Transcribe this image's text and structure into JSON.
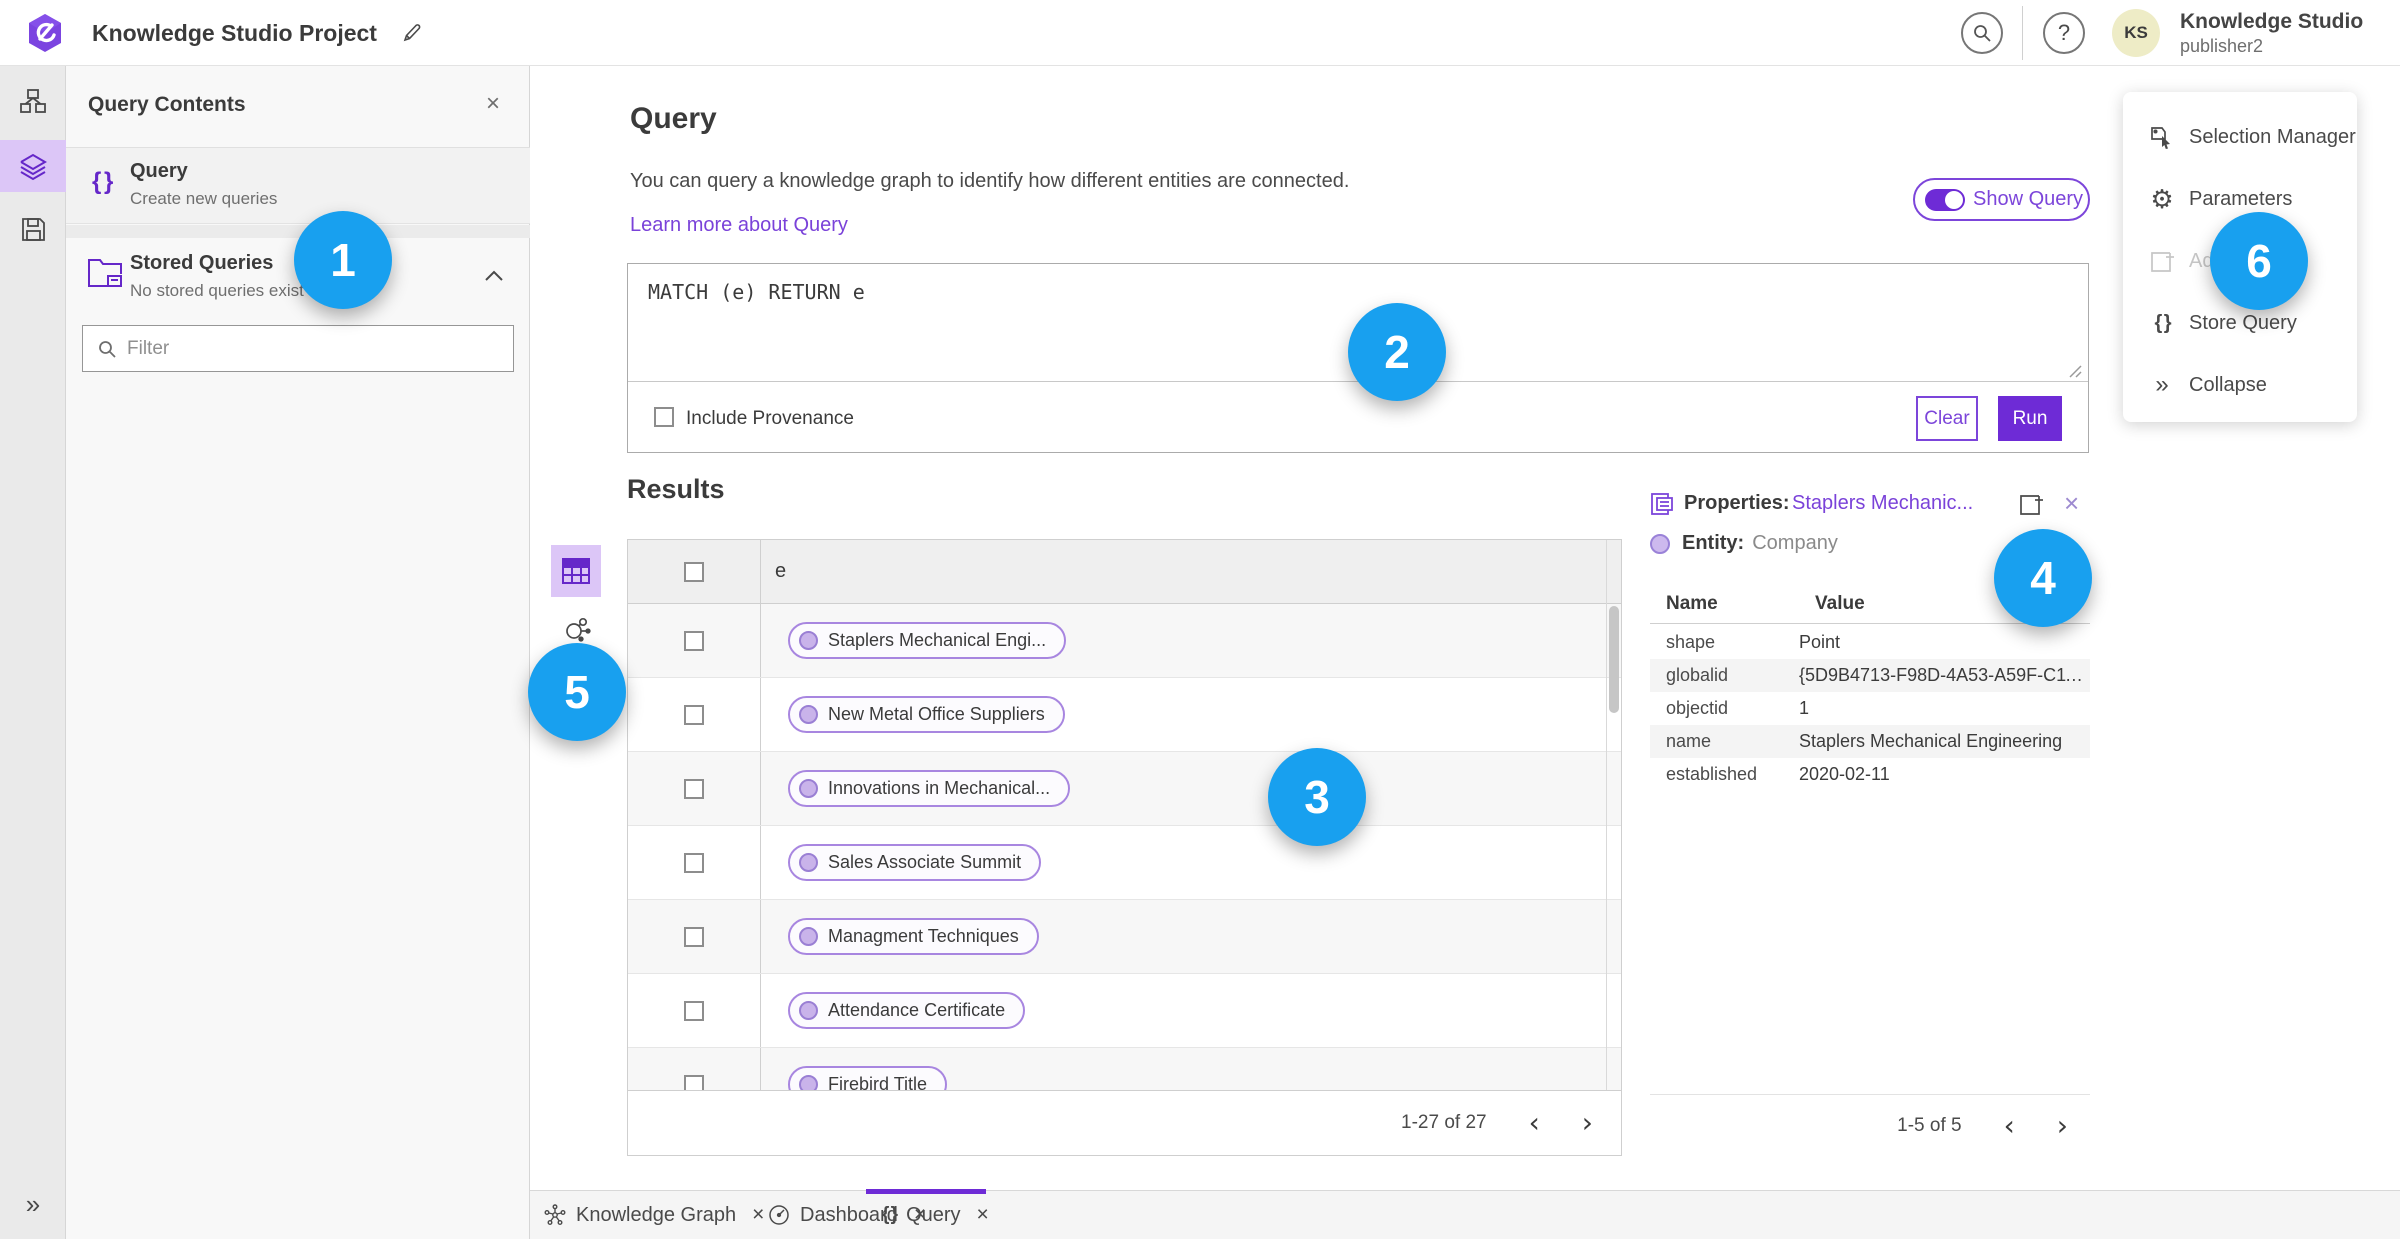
{
  "topbar": {
    "title": "Knowledge Studio Project",
    "user_name": "Knowledge Studio",
    "user_role": "publisher2",
    "avatar_initials": "KS"
  },
  "left_panel": {
    "header": "Query Contents",
    "query_item": {
      "title": "Query",
      "subtitle": "Create new queries"
    },
    "stored_item": {
      "title": "Stored Queries",
      "subtitle": "No stored queries exist"
    },
    "filter_placeholder": "Filter"
  },
  "query_section": {
    "title": "Query",
    "description": "You can query a knowledge graph to identify how different entities are connected.",
    "link": "Learn more about Query",
    "show_query": "Show Query",
    "query_text": "MATCH (e) RETURN e",
    "include_provenance": "Include Provenance",
    "clear": "Clear",
    "run": "Run"
  },
  "results": {
    "title": "Results",
    "column": "e",
    "rows": [
      "Staplers Mechanical Engi...",
      "New Metal Office Suppliers",
      "Innovations in Mechanical...",
      "Sales Associate Summit",
      "Managment Techniques",
      "Attendance Certificate",
      "Firebird Title"
    ],
    "pagination": "1-27 of 27"
  },
  "properties": {
    "label": "Properties:",
    "entity_link": "Staplers Mechanic...",
    "entity_label": "Entity:",
    "entity_type": "Company",
    "col_name": "Name",
    "col_value": "Value",
    "rows": [
      [
        "shape",
        "Point"
      ],
      [
        "globalid",
        "{5D9B4713-F98D-4A53-A59F-C11..."
      ],
      [
        "objectid",
        "1"
      ],
      [
        "name",
        "Staplers Mechanical Engineering"
      ],
      [
        "established",
        "2020-02-11"
      ]
    ],
    "pagination": "1-5 of 5"
  },
  "side_menu": {
    "items": [
      "Selection Manager",
      "Parameters",
      "Add",
      "Store Query",
      "Collapse"
    ]
  },
  "tabs": [
    {
      "label": "Knowledge Graph"
    },
    {
      "label": "Dashboard"
    },
    {
      "label": "Query"
    }
  ],
  "callouts": [
    "1",
    "2",
    "3",
    "4",
    "5",
    "6"
  ],
  "icons": {
    "braces": "{ }",
    "close": "×",
    "question": "?",
    "collapse": "»",
    "expand": "»",
    "gear": "⚙",
    "prev": "‹",
    "next": "›"
  },
  "colors": {
    "primary_purple": "#6e2bd6",
    "accent_purple": "#7a42d9",
    "light_purple": "#dcc6f7",
    "callout_blue": "#18a0ef"
  }
}
